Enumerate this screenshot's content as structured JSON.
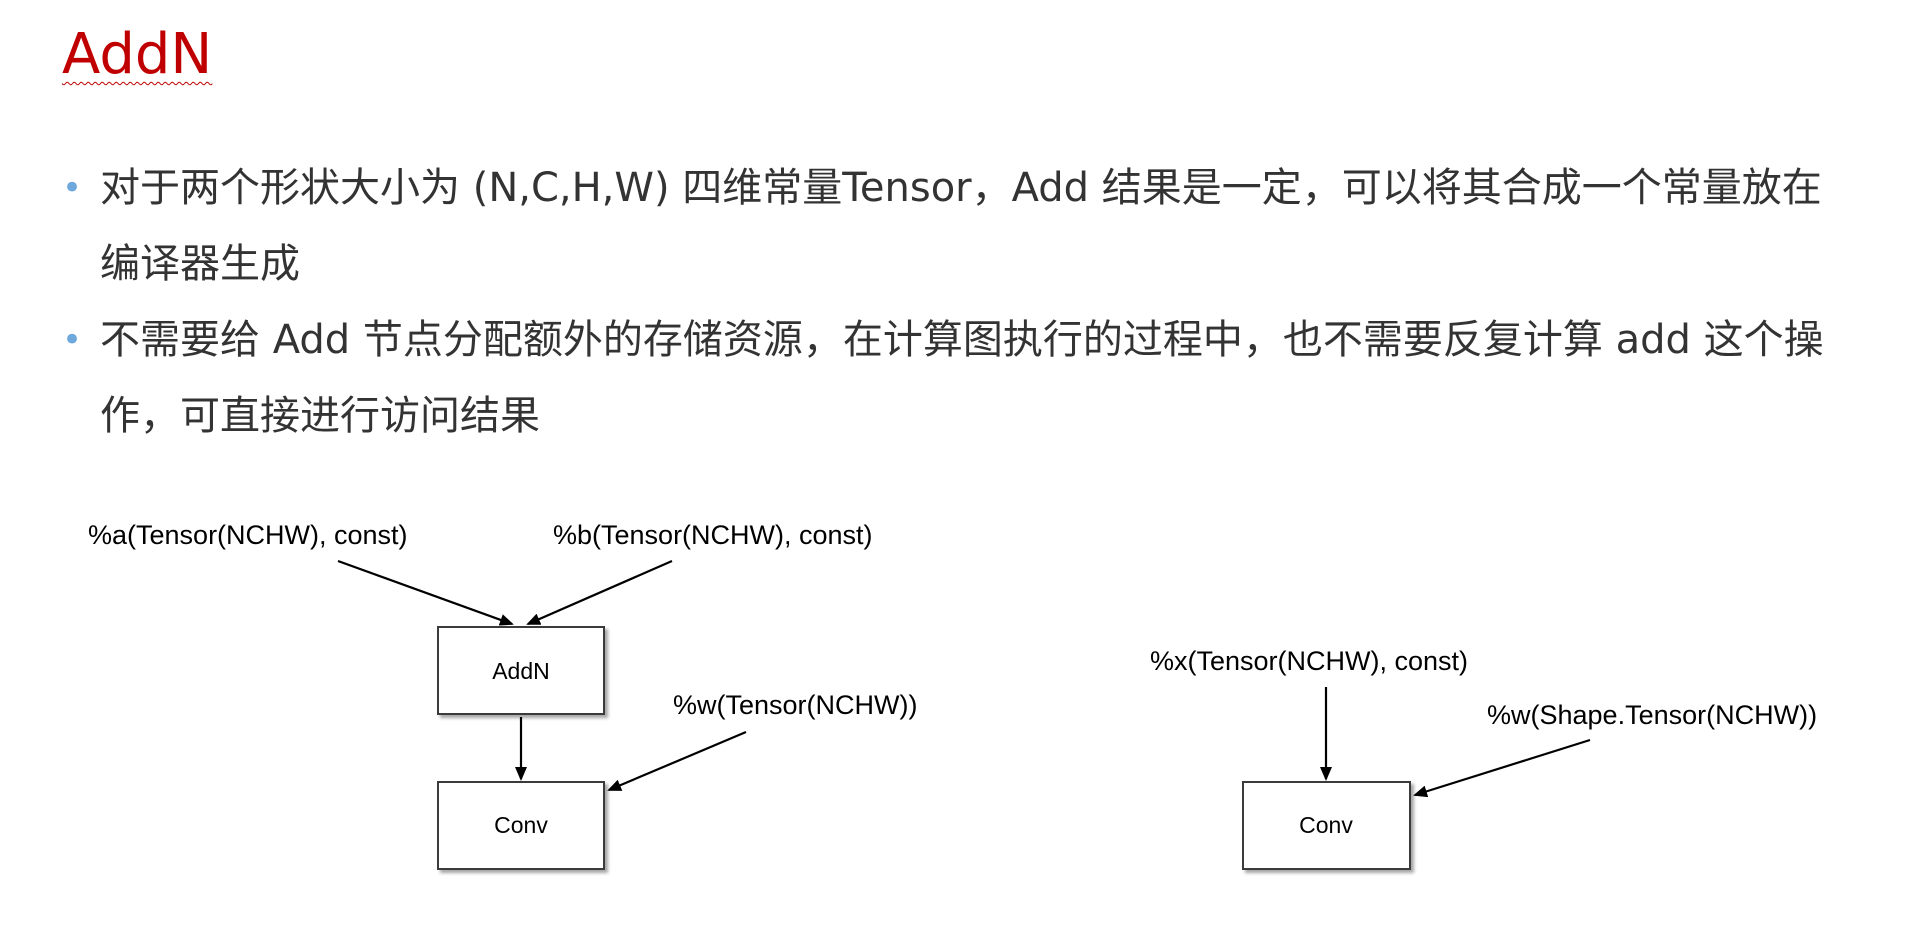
{
  "slide": {
    "title": "AddN",
    "title_color": "#c00000",
    "bullet_color": "#6fa8dc",
    "bullets": [
      "对于两个形状大小为 (N,C,H,W) 四维常量Tensor，Add 结果是一定，可以将其合成一个常量放在编译器生成",
      "不需要给 Add 节点分配额外的存储资源，在计算图执行的过程中，也不需要反复计算 add 这个操作，可直接进行访问结果"
    ]
  },
  "diagram": {
    "before": {
      "inputs": {
        "a": "%a(Tensor(NCHW), const)",
        "b": "%b(Tensor(NCHW), const)",
        "w": "%w(Tensor(NCHW))"
      },
      "nodes": {
        "addn": "AddN",
        "conv": "Conv"
      }
    },
    "after": {
      "inputs": {
        "x": "%x(Tensor(NCHW), const)",
        "w": "%w(Shape.Tensor(NCHW))"
      },
      "nodes": {
        "conv": "Conv"
      }
    },
    "edges": [
      {
        "from": "%a",
        "to": "AddN"
      },
      {
        "from": "%b",
        "to": "AddN"
      },
      {
        "from": "AddN",
        "to": "Conv"
      },
      {
        "from": "%w",
        "to": "Conv"
      },
      {
        "from": "%x",
        "to": "Conv"
      },
      {
        "from": "%w",
        "to": "Conv"
      }
    ]
  }
}
